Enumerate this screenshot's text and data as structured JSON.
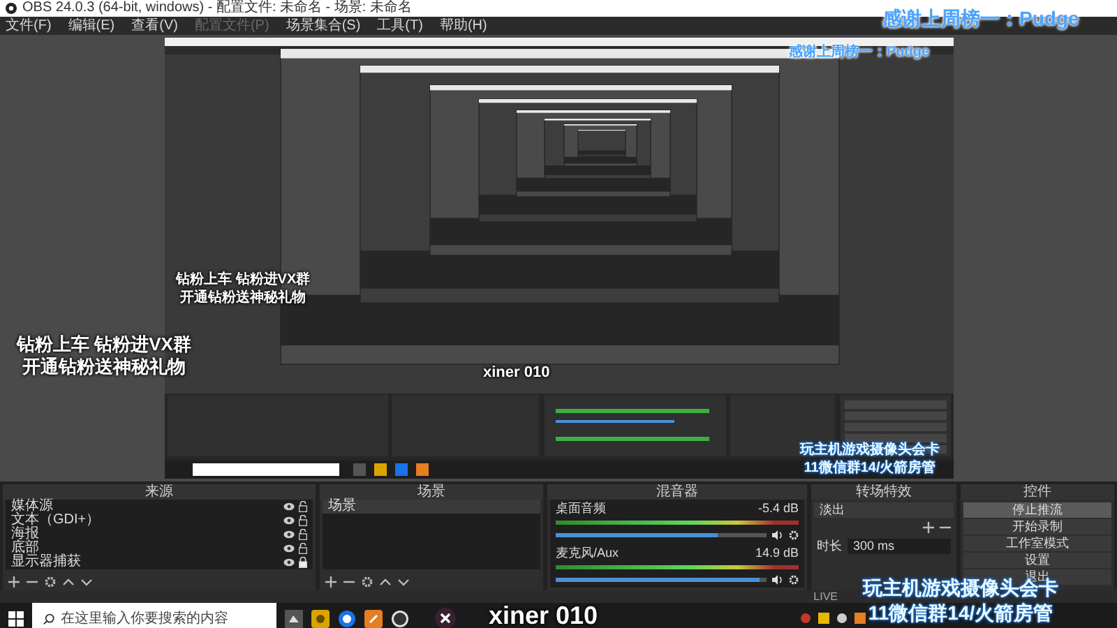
{
  "window": {
    "title": "OBS 24.0.3 (64-bit, windows) - 配置文件: 未命名 - 场景: 未命名"
  },
  "menu": [
    {
      "label": "文件(F)",
      "disabled": false
    },
    {
      "label": "编辑(E)",
      "disabled": false
    },
    {
      "label": "查看(V)",
      "disabled": false
    },
    {
      "label": "配置文件(P)",
      "disabled": true
    },
    {
      "label": "场景集合(S)",
      "disabled": false
    },
    {
      "label": "工具(T)",
      "disabled": false
    },
    {
      "label": "帮助(H)",
      "disabled": false
    }
  ],
  "overlays": {
    "promo": [
      "钻粉上车 钻粉进VX群",
      "开通钻粉送神秘礼物"
    ],
    "thanks": "感谢上周榜一：Pudge",
    "notice": [
      "玩主机游戏摄像头会卡",
      "11微信群14/火箭房管"
    ],
    "streamer": "xiner 010"
  },
  "nested_overlays": {
    "promo": [
      "钻粉上车 钻粉进VX群",
      "开通钻粉送神秘礼物"
    ],
    "thanks": "感谢上周榜一：Pudge",
    "notice": [
      "玩主机游戏摄像头会卡",
      "11微信群14/火箭房管"
    ],
    "streamer": "xiner 010"
  },
  "sources": {
    "title": "来源",
    "items": [
      {
        "label": "媒体源",
        "locked": false
      },
      {
        "label": "文本（GDI+）",
        "locked": false
      },
      {
        "label": "海报",
        "locked": false
      },
      {
        "label": "底部",
        "locked": false
      },
      {
        "label": "显示器捕获",
        "locked": true
      }
    ]
  },
  "scenes": {
    "title": "场景",
    "items": [
      {
        "label": "场景",
        "selected": true
      }
    ]
  },
  "mixer": {
    "title": "混音器",
    "channels": [
      {
        "name": "桌面音频",
        "reading": "-5.4 dB",
        "level": 0.77
      },
      {
        "name": "麦克风/Aux",
        "reading": "14.9 dB",
        "level": 0.97
      }
    ]
  },
  "transitions": {
    "title": "转场特效",
    "selected": "淡出",
    "duration_label": "时长",
    "duration": "300 ms"
  },
  "controls": {
    "title": "控件",
    "buttons": [
      {
        "label": "停止推流",
        "selected": true
      },
      {
        "label": "开始录制",
        "selected": false
      },
      {
        "label": "工作室模式",
        "selected": false
      },
      {
        "label": "设置",
        "selected": false
      },
      {
        "label": "退出",
        "selected": false
      }
    ]
  },
  "status_bar": {
    "live": "LIVE"
  },
  "taskbar": {
    "search": {
      "placeholder": "在这里输入你要搜索的内容"
    }
  }
}
